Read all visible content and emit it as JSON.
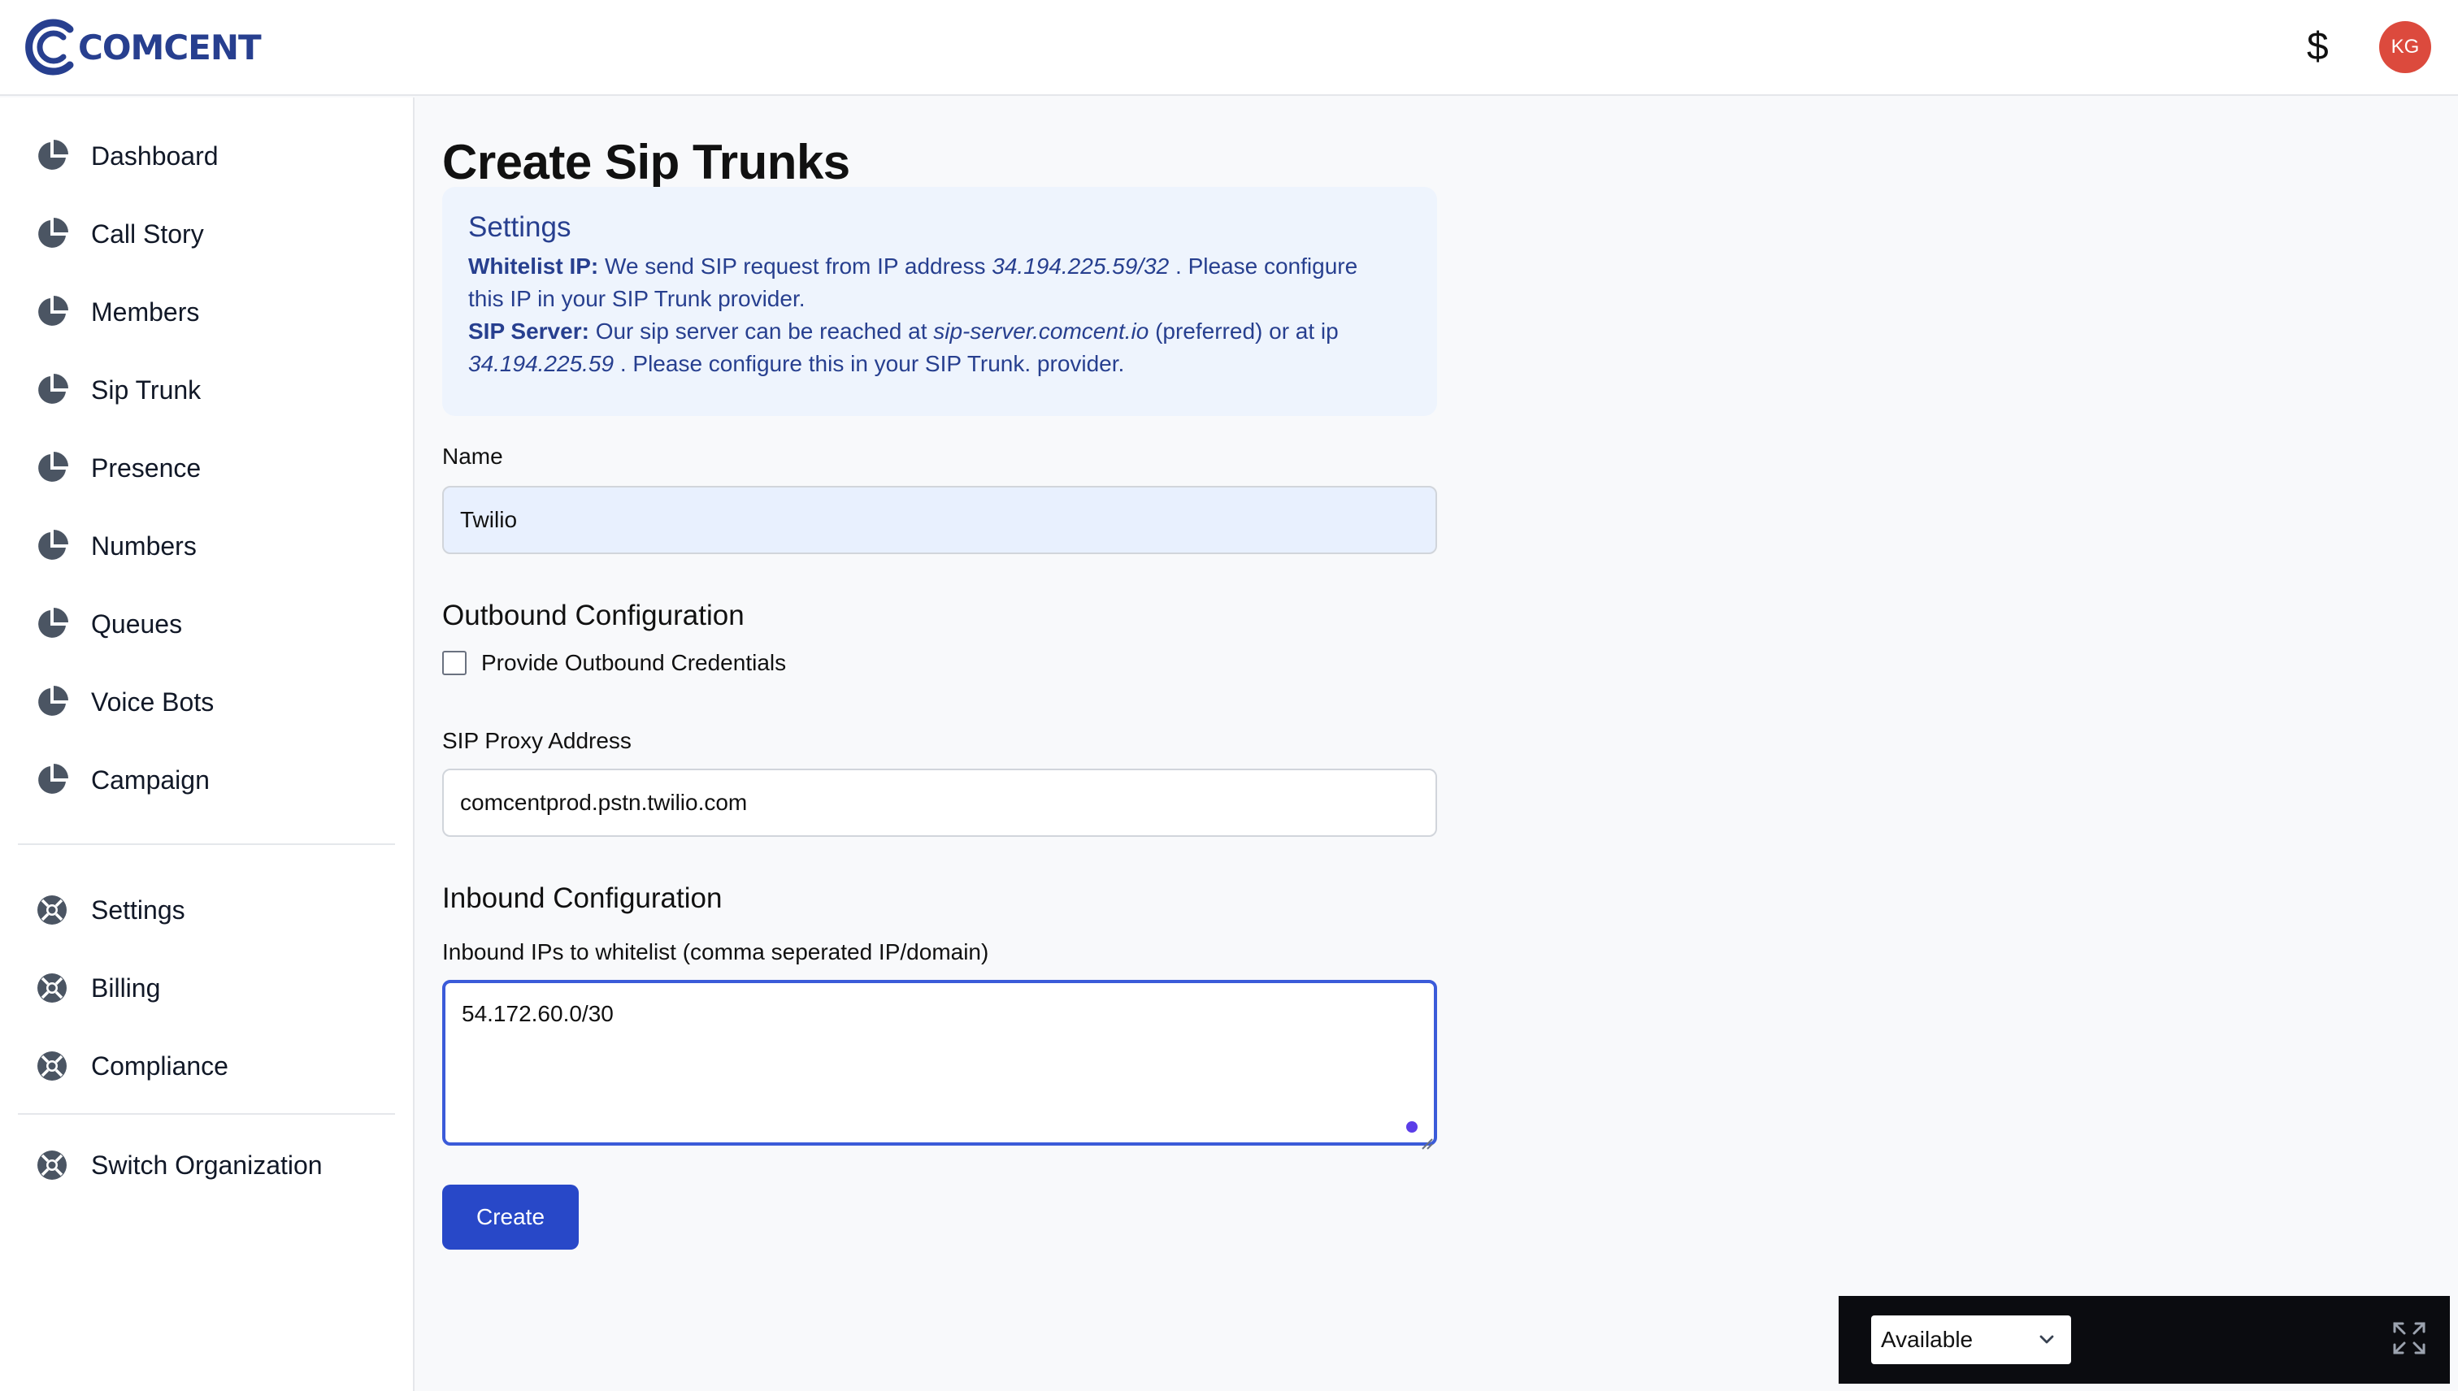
{
  "brand": {
    "name": "COMCENT"
  },
  "header": {
    "currency_symbol": "$",
    "avatar_initials": "KG"
  },
  "sidebar": {
    "items": [
      {
        "label": "Dashboard",
        "icon": "pie-chart-icon"
      },
      {
        "label": "Call Story",
        "icon": "pie-chart-icon"
      },
      {
        "label": "Members",
        "icon": "pie-chart-icon"
      },
      {
        "label": "Sip Trunk",
        "icon": "pie-chart-icon"
      },
      {
        "label": "Presence",
        "icon": "pie-chart-icon"
      },
      {
        "label": "Numbers",
        "icon": "pie-chart-icon"
      },
      {
        "label": "Queues",
        "icon": "pie-chart-icon"
      },
      {
        "label": "Voice Bots",
        "icon": "pie-chart-icon"
      },
      {
        "label": "Campaign",
        "icon": "pie-chart-icon"
      }
    ],
    "secondary": [
      {
        "label": "Settings",
        "icon": "lifebuoy-icon"
      },
      {
        "label": "Billing",
        "icon": "lifebuoy-icon"
      },
      {
        "label": "Compliance",
        "icon": "lifebuoy-icon"
      }
    ],
    "footer": [
      {
        "label": "Switch Organization",
        "icon": "lifebuoy-icon"
      }
    ]
  },
  "main": {
    "title": "Create Sip Trunks",
    "info": {
      "title": "Settings",
      "whitelist_label": "Whitelist IP:",
      "whitelist_text_1": "We send SIP request from IP address",
      "whitelist_ip": "34.194.225.59/32",
      "whitelist_text_2": ". Please configure",
      "whitelist_text_3": "this IP in your SIP Trunk provider.",
      "server_label": "SIP Server:",
      "server_text_1": "Our sip server can be reached at",
      "server_host": "sip-server.comcent.io",
      "server_text_2": "(preferred) or at ip",
      "server_ip": "34.194.225.59",
      "server_text_3": ". Please configure this in your SIP Trunk. provider."
    },
    "name_label": "Name",
    "name_value": "Twilio",
    "outbound_title": "Outbound Configuration",
    "outbound_checkbox_label": "Provide Outbound Credentials",
    "outbound_checkbox_checked": false,
    "proxy_label": "SIP Proxy Address",
    "proxy_value": "comcentprod.pstn.twilio.com",
    "inbound_title": "Inbound Configuration",
    "inbound_label": "Inbound IPs to whitelist (comma seperated IP/domain)",
    "inbound_value": "54.172.60.0/30",
    "create_label": "Create"
  },
  "status_widget": {
    "selected": "Available",
    "options": [
      "Available"
    ]
  },
  "colors": {
    "brand": "#273f8f",
    "primary_button": "#2848c8",
    "avatar": "#dc4a3d",
    "info_bg": "#eef4fd"
  }
}
